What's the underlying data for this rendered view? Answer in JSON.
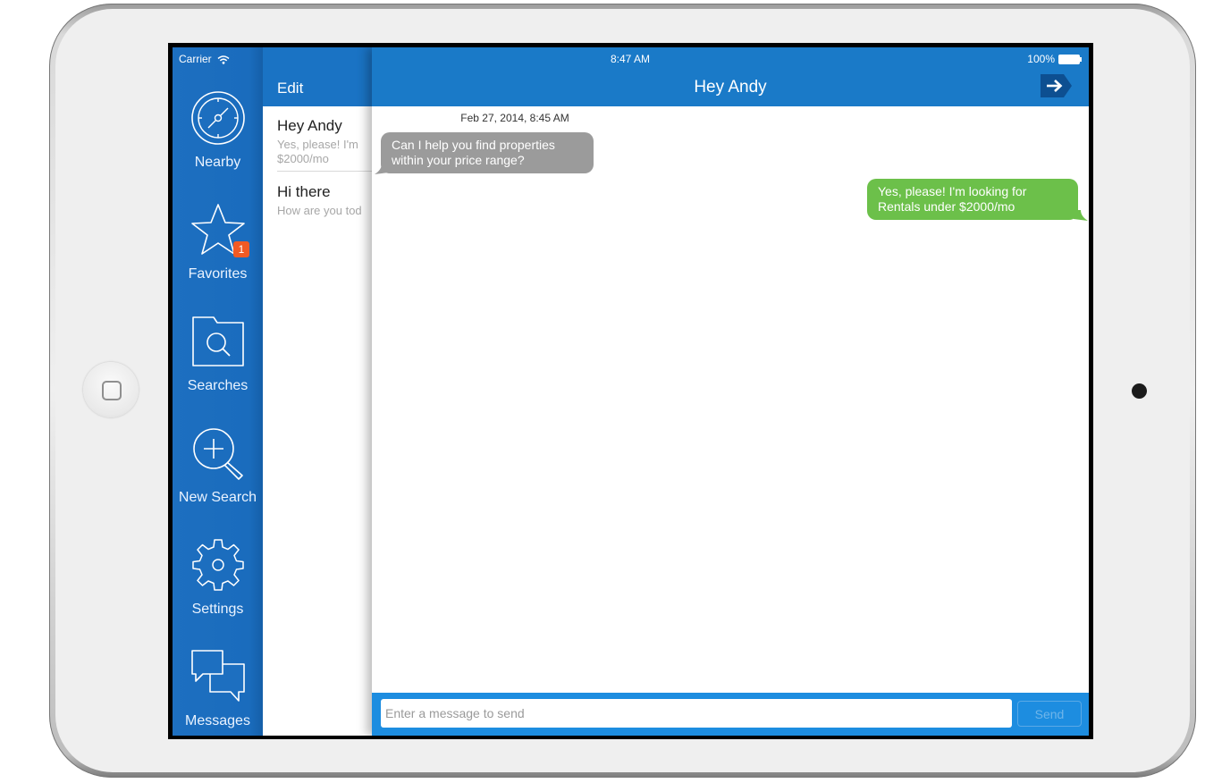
{
  "status_bar": {
    "carrier": "Carrier",
    "time": "8:47 AM",
    "battery": "100%"
  },
  "sidebar": {
    "items": [
      {
        "label": "Nearby",
        "icon": "compass-icon"
      },
      {
        "label": "Favorites",
        "icon": "star-icon",
        "badge": "1"
      },
      {
        "label": "Searches",
        "icon": "folder-search-icon"
      },
      {
        "label": "New Search",
        "icon": "magnifier-plus-icon"
      },
      {
        "label": "Settings",
        "icon": "gear-icon"
      },
      {
        "label": "Messages",
        "icon": "chat-bubbles-icon"
      }
    ]
  },
  "list": {
    "edit_label": "Edit",
    "conversations": [
      {
        "title": "Hey Andy",
        "snippet": "Yes, please! I'm\n$2000/mo"
      },
      {
        "title": "Hi there",
        "snippet": "How are you tod"
      }
    ]
  },
  "chat": {
    "title": "Hey Andy",
    "exit_icon": "arrow-right-icon",
    "timestamp": "Feb 27, 2014, 8:45 AM",
    "messages": [
      {
        "direction": "incoming",
        "text": "Can I help you find properties within your price range?"
      },
      {
        "direction": "outgoing",
        "text": "Yes, please! I'm looking for Rentals under $2000/mo"
      }
    ],
    "composer": {
      "placeholder": "Enter a message to send",
      "send_label": "Send"
    }
  },
  "colors": {
    "primary": "#1a7ac8",
    "sidebar": "#1d6fc0",
    "incoming_bubble": "#9b9b9b",
    "outgoing_bubble": "#6cc04a",
    "badge": "#f15a24"
  }
}
